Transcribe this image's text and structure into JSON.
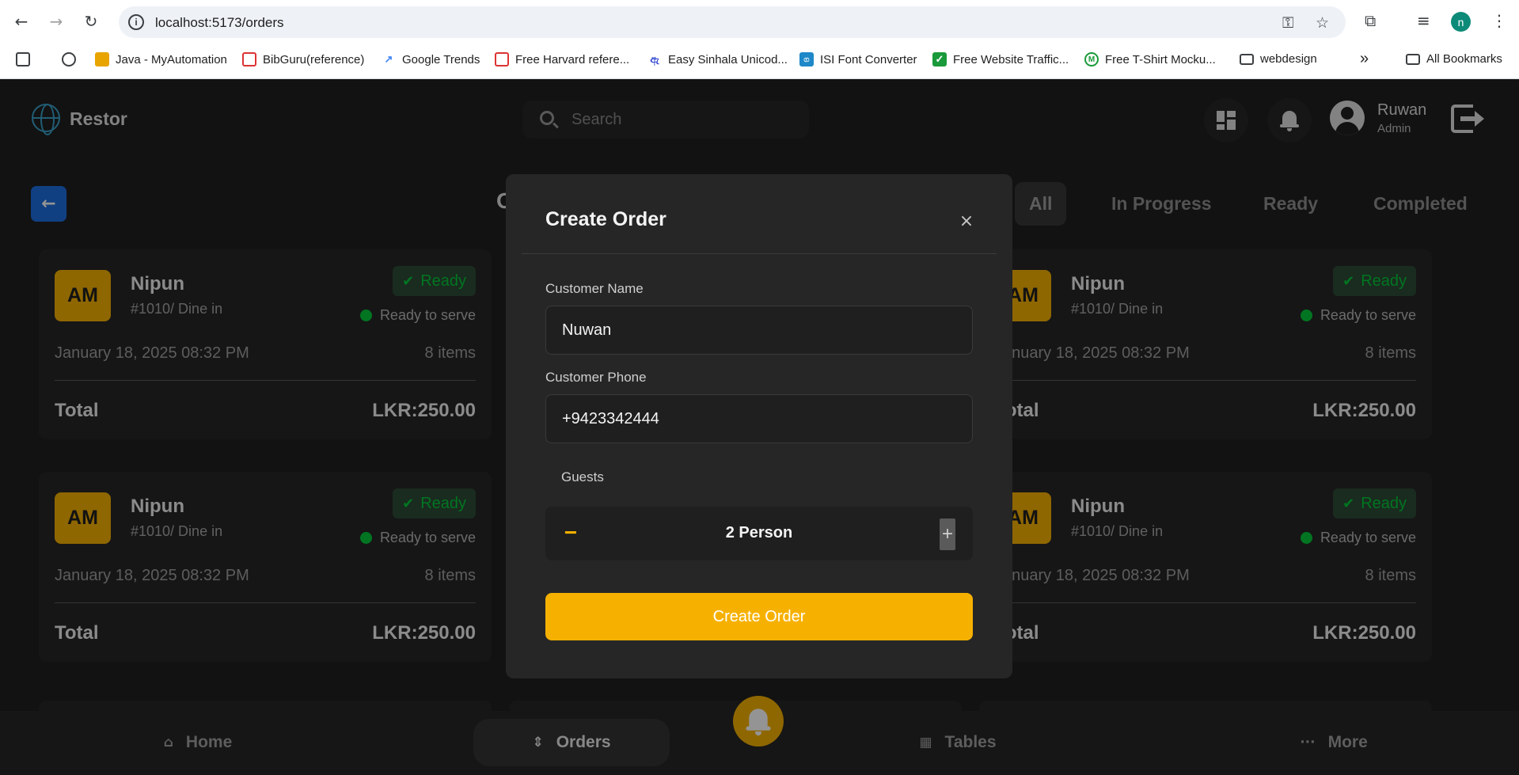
{
  "browser": {
    "url": "localhost:5173/orders",
    "profile_initial": "n",
    "bookmarks": [
      {
        "label": "Java - MyAutomation"
      },
      {
        "label": "BibGuru(reference)"
      },
      {
        "label": "Google Trends"
      },
      {
        "label": "Free Harvard refere..."
      },
      {
        "label": "Easy Sinhala Unicod..."
      },
      {
        "label": "ISI Font Converter"
      },
      {
        "label": "Free Website Traffic..."
      },
      {
        "label": "Free T-Shirt Mocku..."
      },
      {
        "label": "webdesign"
      }
    ],
    "more_bookmarks": "»",
    "all_bookmarks": "All Bookmarks"
  },
  "header": {
    "brand": "Restor",
    "search_placeholder": "Search",
    "user_name": "Ruwan",
    "user_role": "Admin"
  },
  "page": {
    "title_peek": "O",
    "filters": [
      {
        "label": "All",
        "active": true
      },
      {
        "label": "In Progress"
      },
      {
        "label": "Ready"
      },
      {
        "label": "Completed"
      }
    ]
  },
  "orders": [
    {
      "initials": "AM",
      "name": "Nipun",
      "meta": "#1010/ Dine in",
      "status": "Ready",
      "status_text": "Ready to serve",
      "date": "January 18, 2025 08:32 PM",
      "items": "8 items",
      "total_label": "Total",
      "total": "LKR:250.00"
    },
    {
      "initials": "AM",
      "name": "Nipun",
      "meta": "#1010/ Dine in",
      "status": "Ready",
      "status_text": "Ready to serve",
      "date": "January 18, 2025 08:32 PM",
      "items": "8 items",
      "total_label": "Total",
      "total": "LKR:250.00"
    },
    {
      "initials": "AM",
      "name": "Nipun",
      "meta": "#1010/ Dine in",
      "status": "Ready",
      "status_text": "Ready to serve",
      "date": "January 18, 2025 08:32 PM",
      "items": "8 items",
      "total_label": "Total",
      "total": "LKR:250.00"
    },
    {
      "initials": "AM",
      "name": "Nipun",
      "meta": "#1010/ Dine in",
      "status": "Ready",
      "status_text": "Ready to serve",
      "date": "January 18, 2025 08:32 PM",
      "items": "8 items",
      "total_label": "Total",
      "total": "LKR:250.00"
    }
  ],
  "bottom_nav": {
    "home": "Home",
    "orders": "Orders",
    "tables": "Tables",
    "more": "More"
  },
  "modal": {
    "title": "Create Order",
    "close_glyph": "×",
    "name_label": "Customer Name",
    "name_value": "Nuwan",
    "phone_label": "Customer Phone",
    "phone_value": "+9423342444",
    "guests_label": "Guests",
    "guests_value": "2 Person",
    "minus": "−",
    "plus": "+",
    "submit": "Create Order"
  },
  "colors": {
    "accent": "#f6b100",
    "ready_green": "#02ca3a",
    "back_button": "#1e6fe0",
    "background": "#1f1f1f",
    "card": "#262626"
  }
}
